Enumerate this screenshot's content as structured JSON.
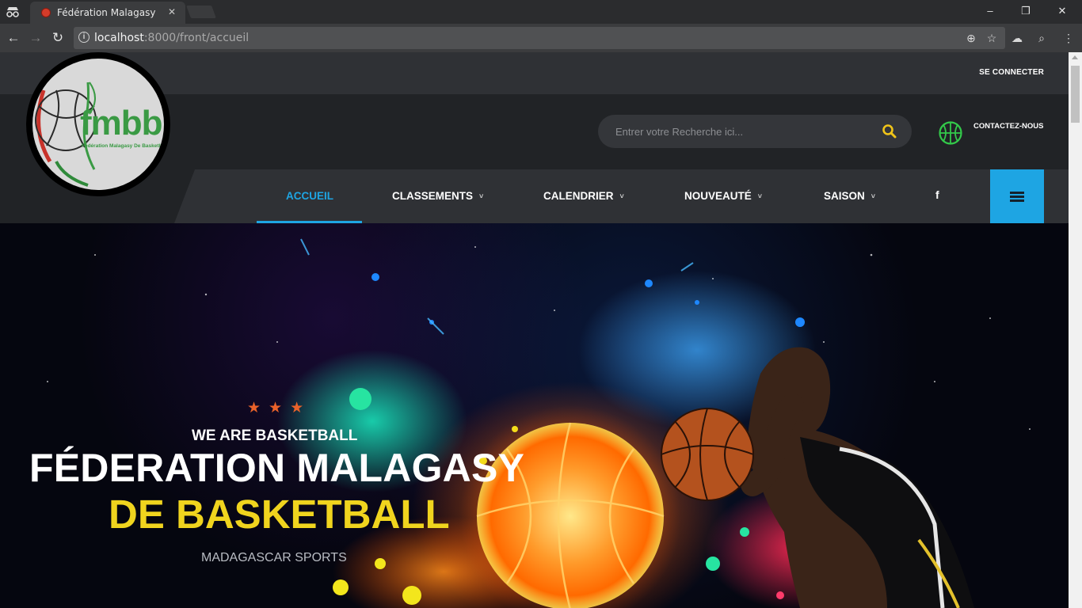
{
  "browser": {
    "tab_title": "Fédération Malagasy de",
    "url_host": "localhost",
    "url_path": ":8000/front/accueil"
  },
  "header": {
    "login_label": "SE CONNECTER",
    "search_placeholder": "Entrer votre Recherche ici...",
    "contact_label": "CONTACTEZ-NOUS",
    "logo_text": "fmbb",
    "logo_subtext": "Fédération Malagasy De Basketball"
  },
  "nav": {
    "items": [
      {
        "label": "ACCUEIL",
        "active": true
      },
      {
        "label": "CLASSEMENTS",
        "caret": "˅"
      },
      {
        "label": "CALENDRIER",
        "caret": "˅"
      },
      {
        "label": "NOUVEAUTÉ",
        "caret": "˅"
      },
      {
        "label": "SAISON",
        "caret": "˅"
      }
    ],
    "facebook_glyph": "f"
  },
  "hero": {
    "stars": "★★★",
    "tagline": "WE ARE BASKETBALL",
    "title_line1": "FÉDERATION MALAGASY",
    "title_line2": "DE BASKETBALL",
    "subtitle": "MADAGASCAR SPORTS"
  },
  "colors": {
    "accent": "#1ea5e3",
    "title_yellow": "#f0d41e",
    "star_orange": "#e9622a"
  }
}
